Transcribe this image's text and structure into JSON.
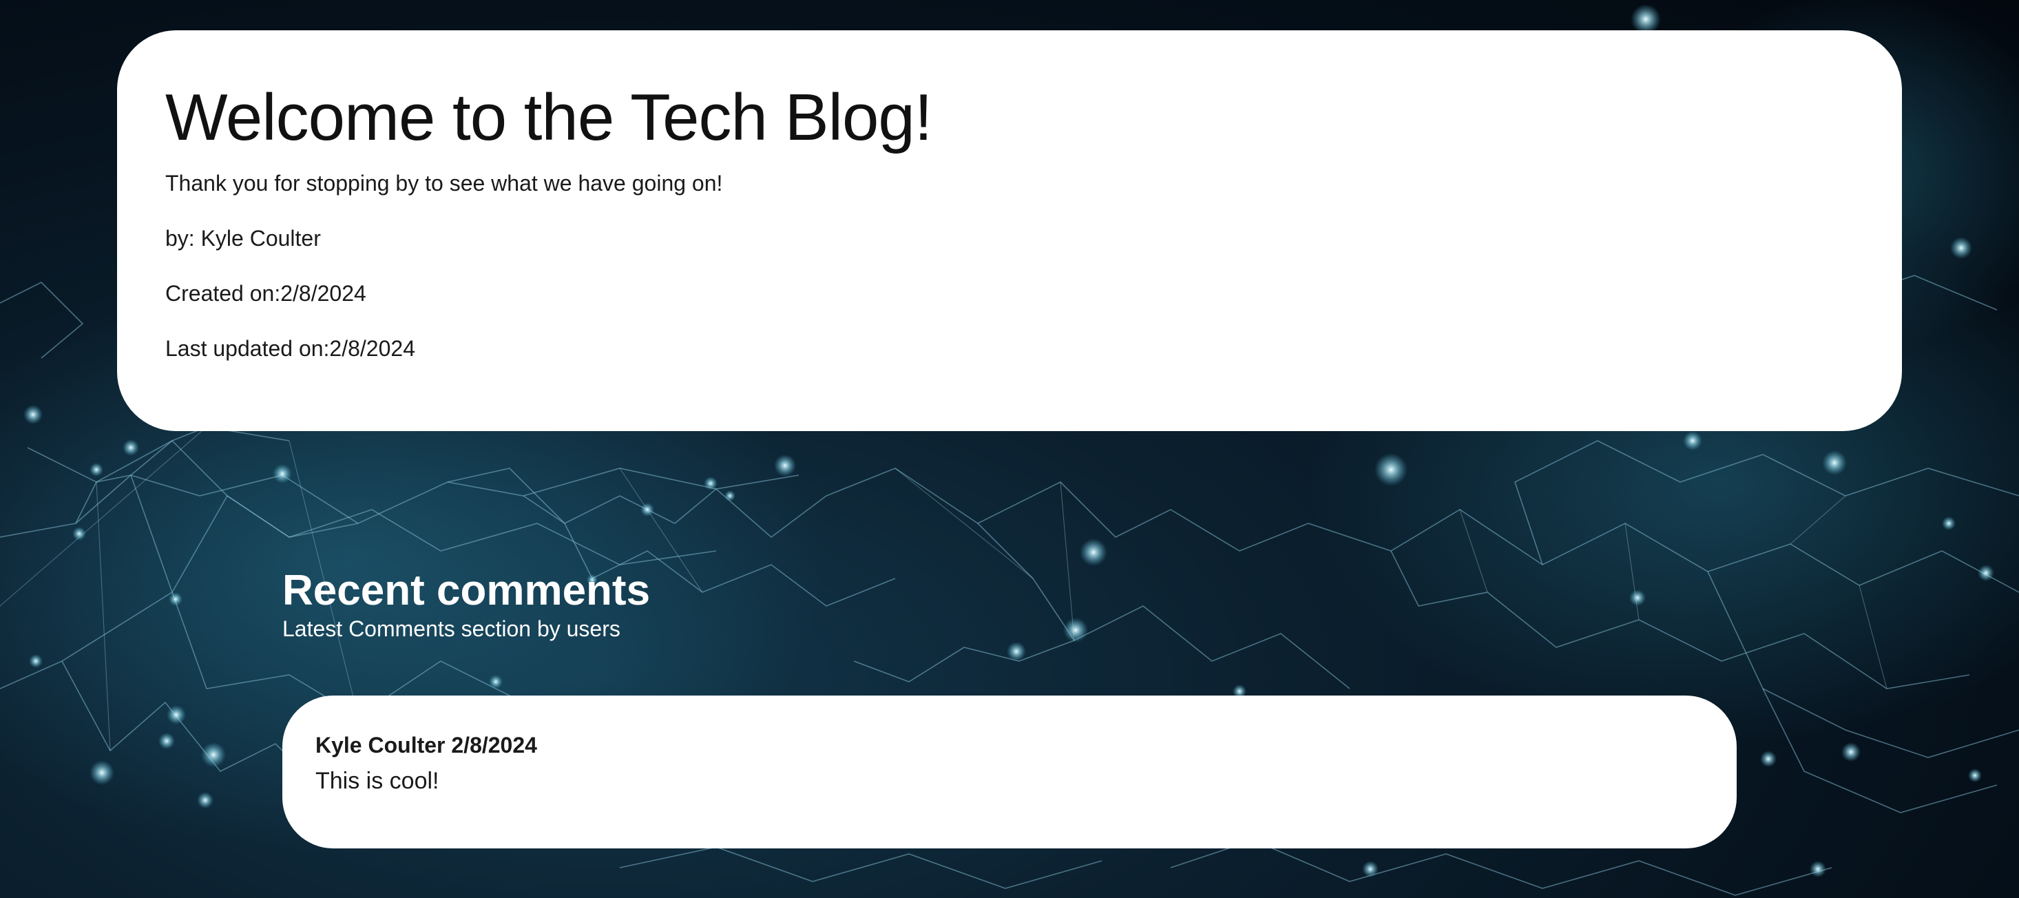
{
  "hero": {
    "title": "Welcome to the Tech Blog!",
    "tagline": "Thank you for stopping by to see what we have going on!",
    "author": "by: Kyle Coulter",
    "created": "Created on:2/8/2024",
    "updated": "Last updated on:2/8/2024"
  },
  "comments": {
    "title": "Recent comments",
    "subtitle": "Latest Comments section by users",
    "items": [
      {
        "header": "Kyle Coulter 2/8/2024",
        "body": "This is cool!"
      }
    ]
  },
  "theme": {
    "card_bg": "#ffffff",
    "page_bg": "#05101a",
    "node_color": "#bfeeff",
    "line_color": "#7fb6cc"
  }
}
